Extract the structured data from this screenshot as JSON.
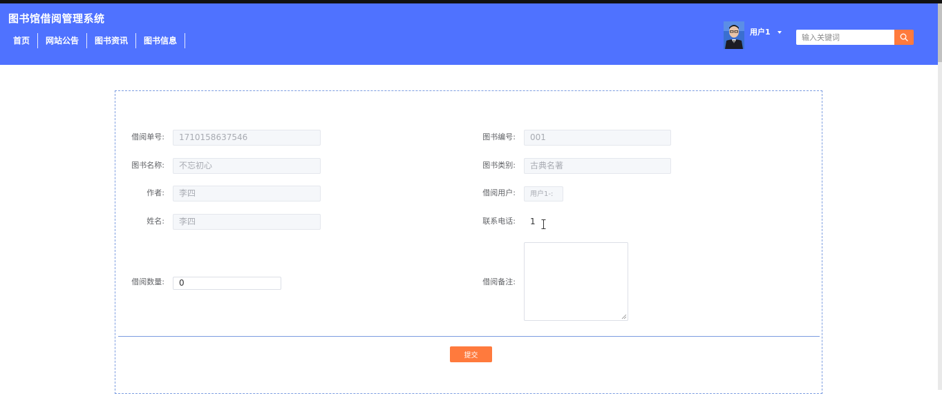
{
  "app": {
    "title": "图书馆借阅管理系统"
  },
  "nav": {
    "items": [
      {
        "label": "首页"
      },
      {
        "label": "网站公告"
      },
      {
        "label": "图书资讯"
      },
      {
        "label": "图书信息"
      }
    ]
  },
  "user": {
    "name": "用户1",
    "avatar_icon": "user-avatar",
    "dropdown_icon": "caret-down-icon"
  },
  "search": {
    "placeholder": "输入关键词",
    "value": "",
    "button_icon": "search-icon"
  },
  "form": {
    "borrow_no": {
      "label": "借阅单号:",
      "value": "1710158637546"
    },
    "book_no": {
      "label": "图书编号:",
      "value": "001"
    },
    "book_name": {
      "label": "图书名称:",
      "value": "不忘初心"
    },
    "book_category": {
      "label": "图书类别:",
      "value": "古典名著"
    },
    "author": {
      "label": "作者:",
      "value": "李四"
    },
    "borrow_user": {
      "label": "借阅用户:",
      "value": "用户1-:"
    },
    "name": {
      "label": "姓名:",
      "value": "李四"
    },
    "phone": {
      "label": "联系电话:",
      "value": "1"
    },
    "quantity": {
      "label": "借阅数量:",
      "value": "0"
    },
    "remark": {
      "label": "借阅备注:",
      "value": ""
    },
    "submit_label": "提交"
  },
  "colors": {
    "header_bg": "#4f72ff",
    "accent_orange": "#ff7a3d",
    "panel_border": "#7a9be0"
  }
}
